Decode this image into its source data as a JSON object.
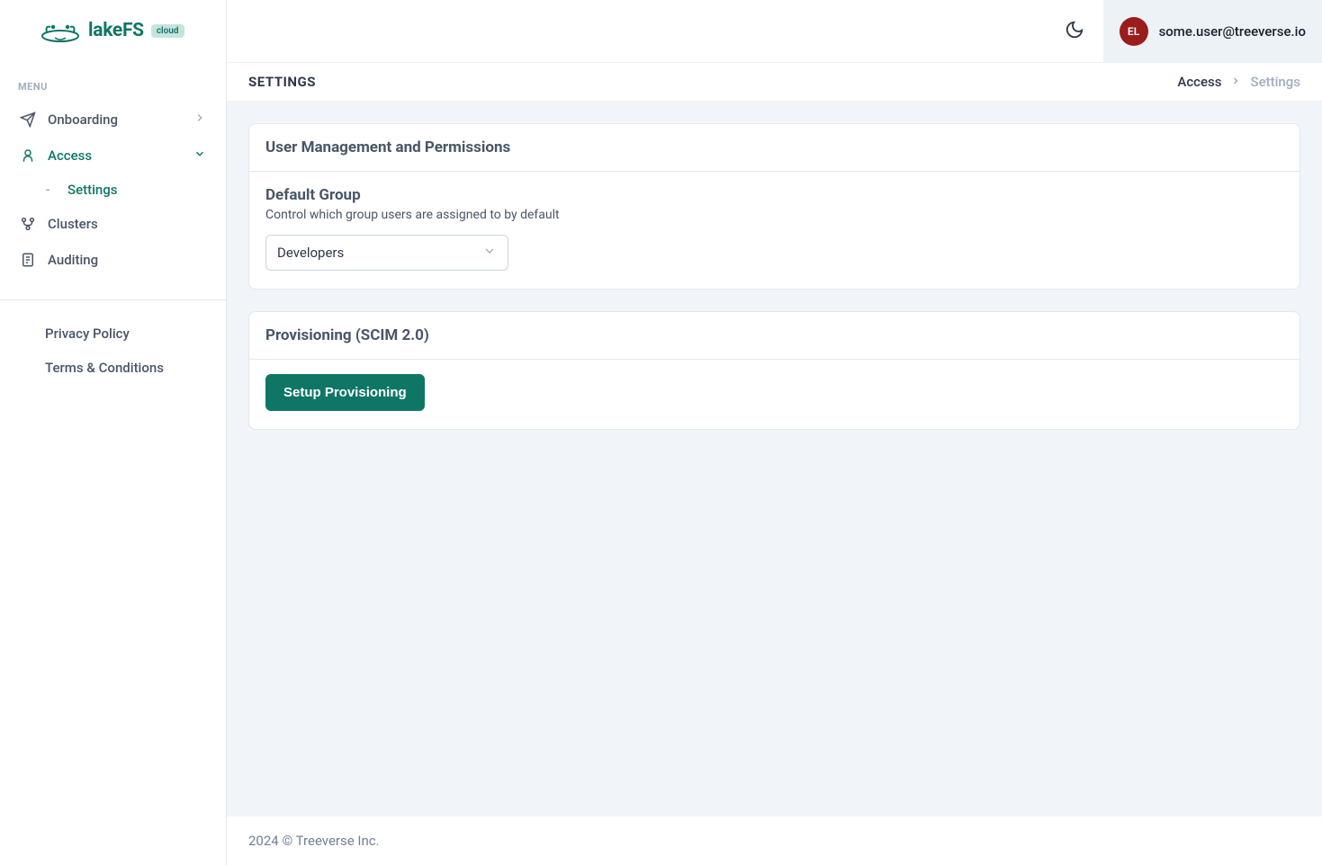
{
  "brand": {
    "name": "lakeFS",
    "badge": "cloud"
  },
  "sidebar": {
    "menu_label": "MENU",
    "items": [
      {
        "label": "Onboarding"
      },
      {
        "label": "Access"
      },
      {
        "label": "Clusters"
      },
      {
        "label": "Auditing"
      }
    ],
    "access_subitems": [
      {
        "label": "Settings"
      }
    ],
    "footer_links": [
      {
        "label": "Privacy Policy"
      },
      {
        "label": "Terms & Conditions"
      }
    ]
  },
  "header": {
    "user_initials": "EL",
    "user_email": "some.user@treeverse.io"
  },
  "page": {
    "title": "SETTINGS",
    "breadcrumb": {
      "parent": "Access",
      "current": "Settings"
    }
  },
  "cards": {
    "user_mgmt": {
      "title": "User Management and Permissions",
      "default_group": {
        "title": "Default Group",
        "desc": "Control which group users are assigned to by default",
        "selected": "Developers"
      }
    },
    "provisioning": {
      "title": "Provisioning (SCIM 2.0)",
      "button": "Setup Provisioning"
    }
  },
  "footer": {
    "copyright": "2024 © Treeverse Inc."
  }
}
